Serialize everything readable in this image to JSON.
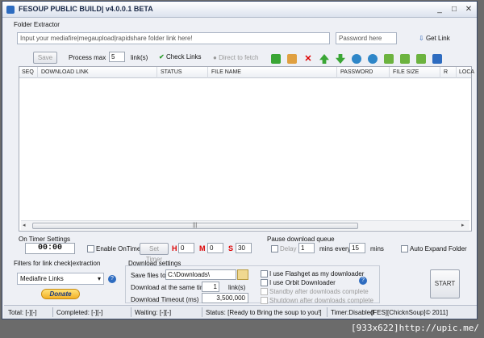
{
  "window": {
    "title": "FESOUP PUBLIC BUILD| v4.0.0.1 BETA",
    "min": "_",
    "max": "□",
    "close": "✕"
  },
  "folder": {
    "section": "Folder Extractor",
    "link_placeholder": "Input your mediafire|megaupload|rapidshare folder link here!",
    "password_placeholder": "Password here",
    "get_link": "Get Link"
  },
  "toolbar": {
    "save": "Save",
    "process_max": "Process max",
    "process_value": "5",
    "links_unit": "link(s)",
    "check_links": "Check Links",
    "direct_to_fetch": "Direct to fetch"
  },
  "table": {
    "columns": [
      "SEQ",
      "DOWNLOAD LINK",
      "STATUS",
      "FILE NAME",
      "PASSWORD",
      "FILE SIZE",
      "R",
      "LOCA"
    ],
    "grip": "|||"
  },
  "timer": {
    "section": "On Timer Settings",
    "display": "00:00",
    "enable": "Enable OnTimer",
    "set": "Set Timer",
    "h_label": "H",
    "h_value": "0",
    "m_label": "M",
    "m_value": "0",
    "s_label": "S",
    "s_value": "30"
  },
  "pause": {
    "section": "Pause download queue",
    "delay": "Delay",
    "delay_value": "1",
    "mins_every": "mins every",
    "every_value": "15",
    "mins": "mins"
  },
  "auto_expand": "Auto Expand Folder",
  "filters": {
    "section": "Filters for link check|extraction",
    "selected": "Mediafire Links",
    "donate": "Donate"
  },
  "download": {
    "section": "Download settings",
    "save_to": "Save files to",
    "save_path": "C:\\Downloads\\",
    "same_time": "Download at the same time",
    "same_time_value": "1",
    "same_time_unit": "link(s)",
    "timeout": "Download Timeout (ms)",
    "timeout_value": "3,500,000",
    "flashget": "I use Flashget as my downloader",
    "orbit": "I use Orbit Downloader",
    "standby": "Standby after downloads complete",
    "shutdown": "Shutdown after downloads complete"
  },
  "start": "START",
  "status": {
    "total": "Total: [-][-]",
    "completed": "Completed: [-][-]",
    "waiting": "Waiting: [-][-]",
    "message": "Status: [Ready to Bring the soup to you!]",
    "timer": "Timer:Disabled",
    "credit": "[FES][ChicknSoup]© 2011]"
  },
  "watermark": "[933x622]http://upic.me/",
  "icons": [
    "check-icon",
    "globe-icon",
    "plus-icon",
    "copy-icon",
    "delete-icon",
    "arrow-up-icon",
    "arrow-down-icon",
    "refresh-icon",
    "search-icon",
    "export-icon",
    "help-icon",
    "folder-icon"
  ]
}
